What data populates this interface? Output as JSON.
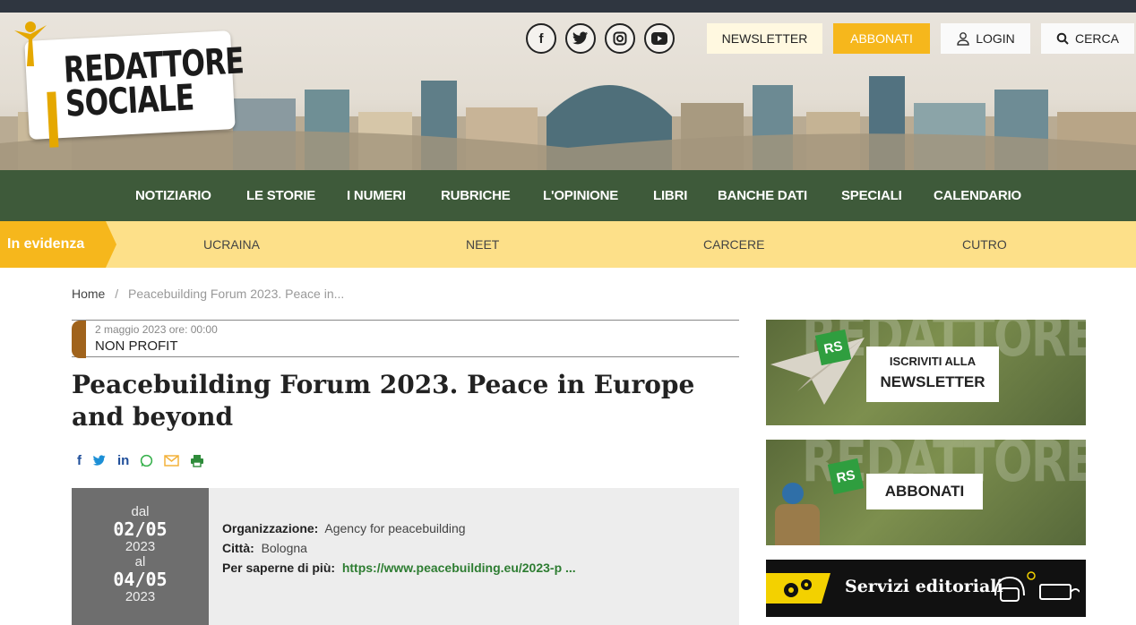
{
  "header": {
    "logo_line1": "REDATTORE",
    "logo_line2": "SOCIALE",
    "social_icons": [
      "facebook-icon",
      "twitter-icon",
      "instagram-icon",
      "youtube-icon"
    ],
    "buttons": {
      "newsletter": "NEWSLETTER",
      "abbonati": "ABBONATI",
      "login": "LOGIN",
      "cerca": "CERCA"
    }
  },
  "nav": {
    "items": [
      "NOTIZIARIO",
      "LE STORIE",
      "I NUMERI",
      "RUBRICHE",
      "L'OPINIONE",
      "LIBRI",
      "BANCHE DATI",
      "SPECIALI",
      "CALENDARIO"
    ]
  },
  "evidenza": {
    "label": "In evidenza",
    "items": [
      "UCRAINA",
      "NEET",
      "CARCERE",
      "CUTRO"
    ]
  },
  "breadcrumb": {
    "home": "Home",
    "sep": "/",
    "current": "Peacebuilding Forum 2023. Peace in..."
  },
  "article": {
    "date": "2 maggio 2023 ore: 00:00",
    "category": "NON PROFIT",
    "title": "Peacebuilding Forum 2023. Peace in Europe and beyond",
    "share_icons": [
      "facebook-share-icon",
      "twitter-share-icon",
      "linkedin-share-icon",
      "whatsapp-share-icon",
      "email-share-icon",
      "print-icon"
    ]
  },
  "event": {
    "dal": "dal",
    "start_day": "02/05",
    "start_year": "2023",
    "al": "al",
    "end_day": "04/05",
    "end_year": "2023",
    "org_label": "Organizzazione:",
    "org_value": "Agency for peacebuilding",
    "city_label": "Città:",
    "city_value": "Bologna",
    "more_label": "Per saperne di più:",
    "more_value": "https://www.peacebuilding.eu/2023-p ..."
  },
  "sidebar": {
    "newsletter_line1": "ISCRIVITI ALLA",
    "newsletter_line2": "NEWSLETTER",
    "abbonati": "ABBONATI",
    "rs": "RS",
    "bg_word": "REDATTORE",
    "servizi": "Servizi editoriali"
  },
  "colors": {
    "nav_green": "#3e5a3a",
    "yellow": "#f6b71c",
    "evidenza_bg": "#fde089",
    "link_green": "#2e7d32",
    "category_brown": "#a0631c"
  }
}
